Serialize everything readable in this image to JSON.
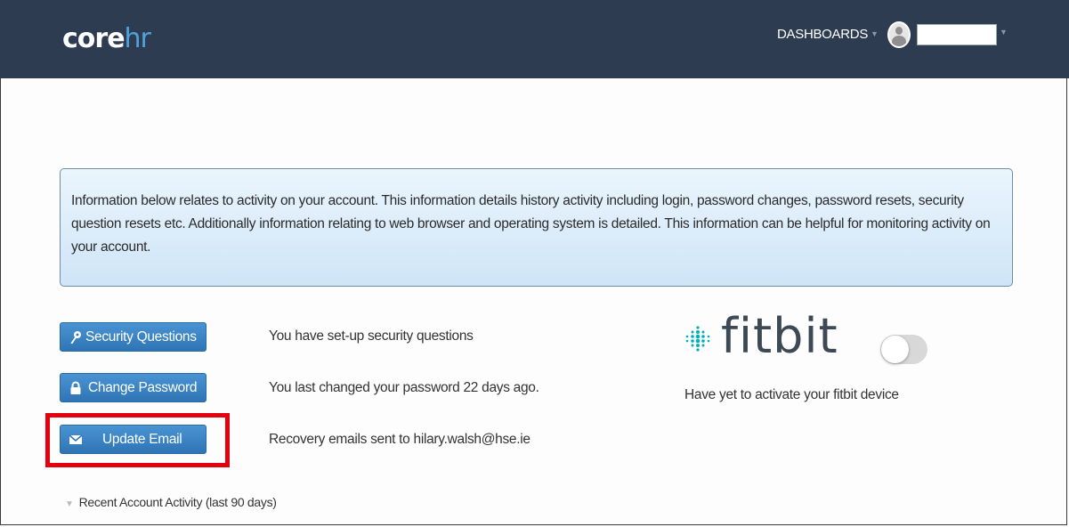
{
  "header": {
    "logo_core": "core",
    "logo_hr": "hr",
    "dashboards_label": "DASHBOARDS",
    "username": ""
  },
  "info": {
    "text": "Information below relates to activity on your account. This information details history activity including login, password changes, password resets, security question resets etc. Additionally information relating to web browser and operating system is detailed. This information can be helpful for monitoring activity on your account."
  },
  "actions": [
    {
      "label": "Security Questions",
      "description": "You have set-up security questions",
      "icon": "key-icon"
    },
    {
      "label": "Change Password",
      "description": "You last changed your password 22 days ago.",
      "icon": "lock-icon"
    },
    {
      "label": "Update Email",
      "description": "Recovery emails sent to hilary.walsh@hse.ie",
      "icon": "envelope-icon"
    }
  ],
  "fitbit": {
    "logo_text": "fitbit",
    "status_text": "Have yet to activate your fitbit device",
    "enabled": false
  },
  "activity": {
    "label": "Recent Account Activity (last 90 days)"
  },
  "colors": {
    "header_bg": "#2d3c50",
    "accent": "#4fa3dc",
    "button": "#3a84c6",
    "highlight": "#e4000f"
  }
}
